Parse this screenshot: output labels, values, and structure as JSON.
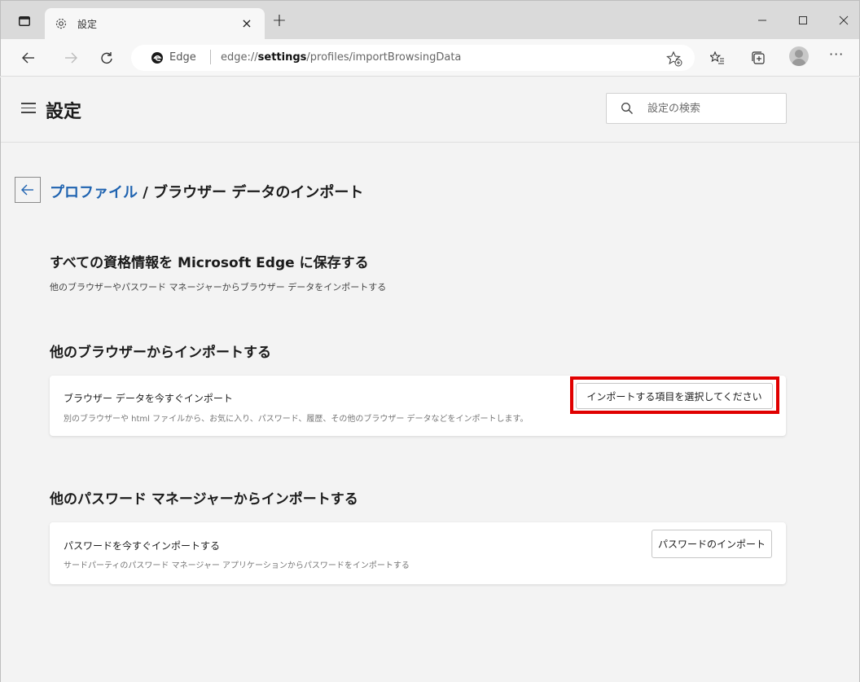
{
  "browser": {
    "tab_title": "設定",
    "tab_close": "×",
    "new_tab": "+",
    "site_name": "Edge",
    "url_prefix": "edge://",
    "url_bold": "settings",
    "url_rest": "/profiles/importBrowsingData",
    "more_label": "···"
  },
  "settings": {
    "title": "設定",
    "search_placeholder": "設定の検索"
  },
  "breadcrumb": {
    "parent": "プロファイル",
    "separator": " / ",
    "current": "ブラウザー データのインポート"
  },
  "sections": {
    "save_title": "すべての資格情報を Microsoft Edge に保存する",
    "save_sub": "他のブラウザーやパスワード マネージャーからブラウザー データをインポートする",
    "browser_heading": "他のブラウザーからインポートする",
    "browser_card": {
      "title": "ブラウザー データを今すぐインポート",
      "desc": "別のブラウザーや html ファイルから、お気に入り、パスワード、履歴、その他のブラウザー データなどをインポートします。",
      "button": "インポートする項目を選択してください"
    },
    "pwm_heading": "他のパスワード マネージャーからインポートする",
    "pwm_card": {
      "title": "パスワードを今すぐインポートする",
      "desc": "サードパーティのパスワード マネージャー アプリケーションからパスワードをインポートする",
      "button": "パスワードのインポート"
    }
  },
  "colors": {
    "link": "#1f63b0",
    "highlight": "#e00000"
  }
}
